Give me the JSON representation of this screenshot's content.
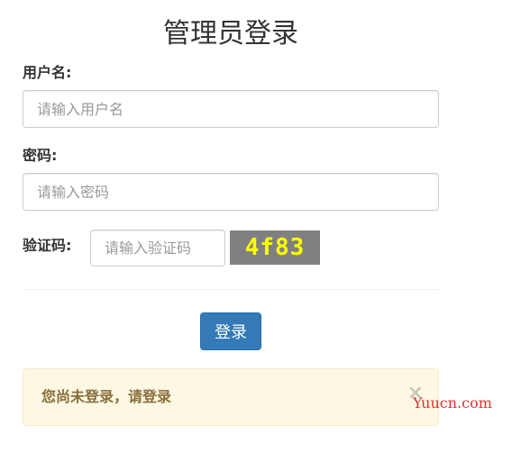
{
  "page_title": "管理员登录",
  "username": {
    "label": "用户名:",
    "placeholder": "请输入用户名",
    "value": ""
  },
  "password": {
    "label": "密码:",
    "placeholder": "请输入密码",
    "value": ""
  },
  "captcha": {
    "label": "验证码:",
    "placeholder": "请输入验证码",
    "value": "",
    "image_text": "4f83",
    "image_bg_color": "#808080",
    "image_text_color": "#ffff00"
  },
  "login_button": {
    "label": "登录",
    "color": "#337ab7"
  },
  "alert": {
    "message": "您尚未登录，请登录",
    "close_glyph": "×",
    "bg_color": "#fcf8e3",
    "text_color": "#8a6d3b"
  },
  "watermark": {
    "text": "Yuucn.com",
    "color": "#e0322f"
  }
}
